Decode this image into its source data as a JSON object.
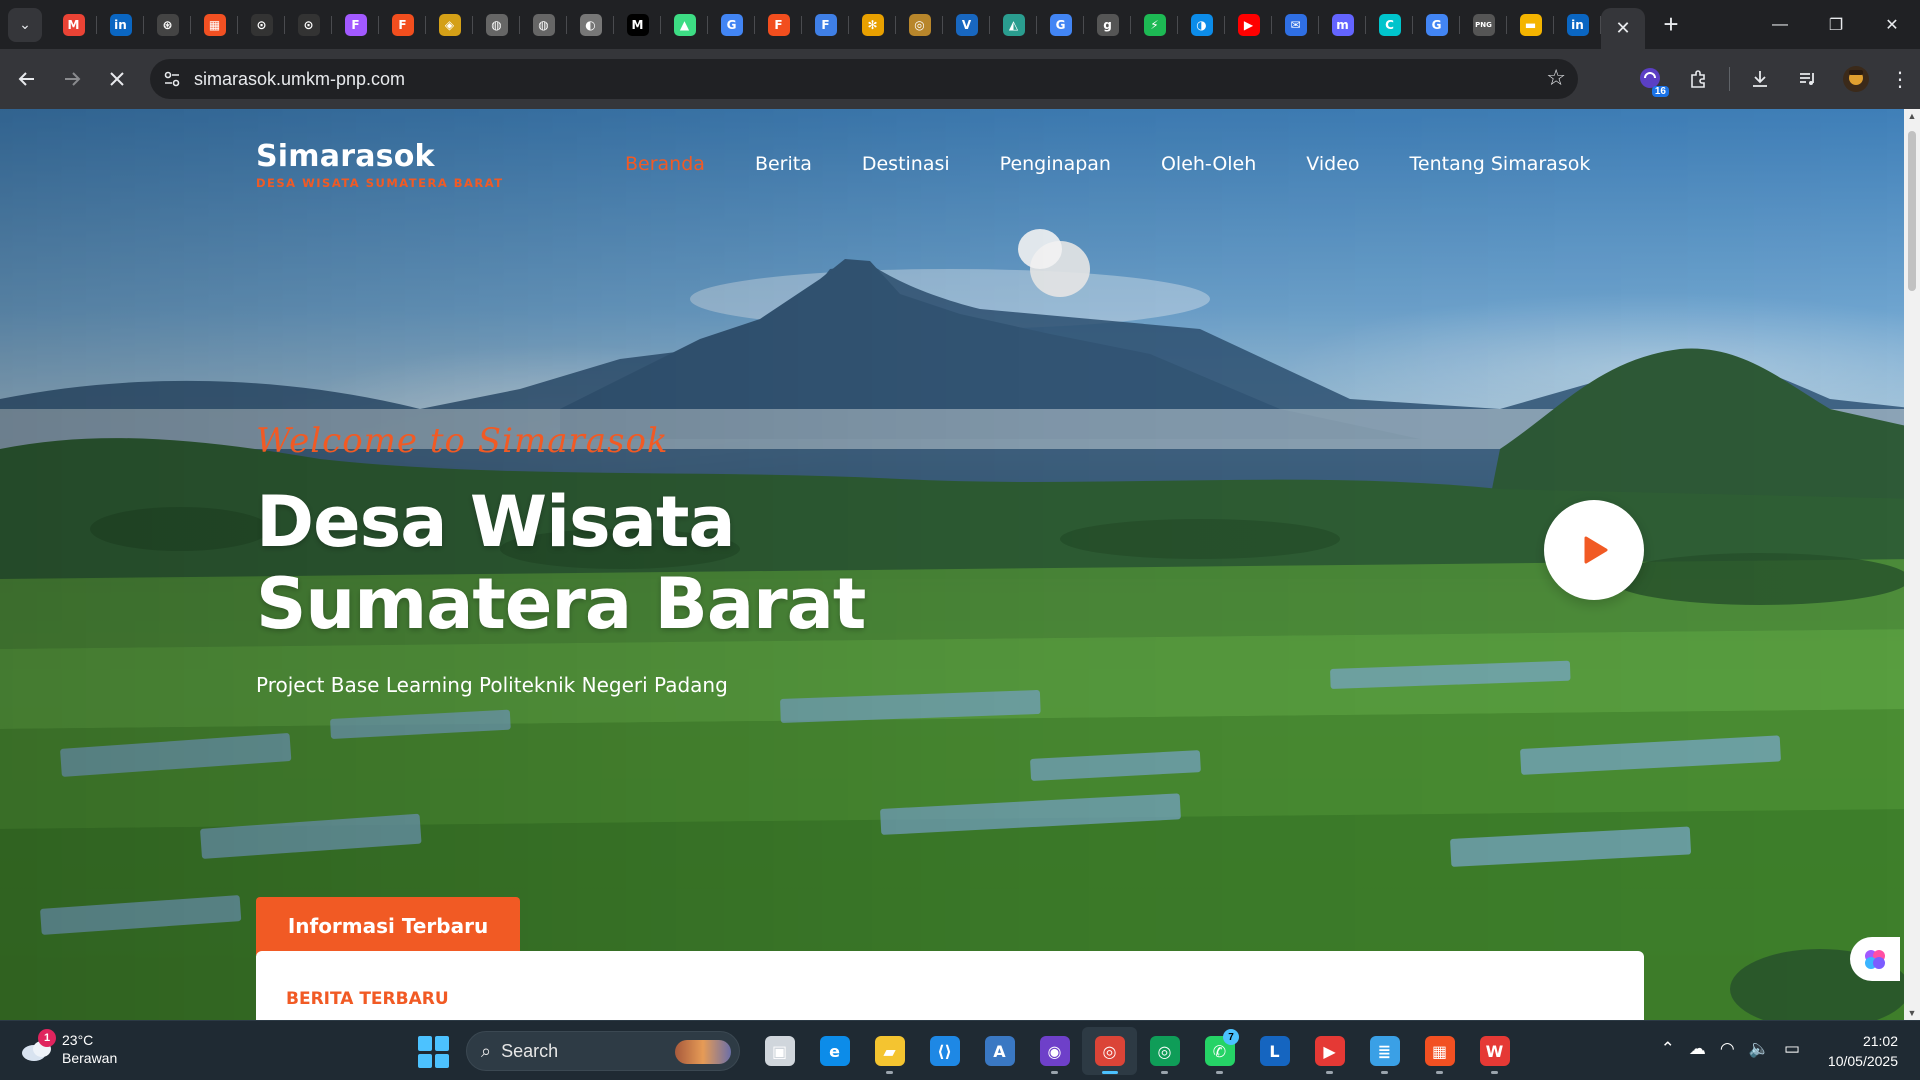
{
  "browser": {
    "pinned_tabs": [
      {
        "name": "gmail",
        "glyph": "M",
        "color": "#ea4335"
      },
      {
        "name": "linkedin",
        "glyph": "in",
        "color": "#0a66c2"
      },
      {
        "name": "openai",
        "glyph": "⊛",
        "color": "#444"
      },
      {
        "name": "microsoft",
        "glyph": "▦",
        "color": "#f25022"
      },
      {
        "name": "github",
        "glyph": "⊙",
        "color": "#333"
      },
      {
        "name": "github-2",
        "glyph": "⊙",
        "color": "#333"
      },
      {
        "name": "figma-circle",
        "glyph": "F",
        "color": "#a259ff"
      },
      {
        "name": "figma",
        "glyph": "F",
        "color": "#f24e1e"
      },
      {
        "name": "shield",
        "glyph": "◈",
        "color": "#d4a017"
      },
      {
        "name": "globe-1",
        "glyph": "◍",
        "color": "#666"
      },
      {
        "name": "globe-2",
        "glyph": "◍",
        "color": "#666"
      },
      {
        "name": "globe-3",
        "glyph": "◐",
        "color": "#777"
      },
      {
        "name": "medium",
        "glyph": "M",
        "color": "#000"
      },
      {
        "name": "android",
        "glyph": "▲",
        "color": "#3ddc84"
      },
      {
        "name": "google",
        "glyph": "G",
        "color": "#4285f4"
      },
      {
        "name": "figma-2",
        "glyph": "F",
        "color": "#f24e1e"
      },
      {
        "name": "forms",
        "glyph": "F",
        "color": "#3f7fe6"
      },
      {
        "name": "chrome-web",
        "glyph": "✻",
        "color": "#e8a000"
      },
      {
        "name": "badge",
        "glyph": "◎",
        "color": "#b8862b"
      },
      {
        "name": "vuetify",
        "glyph": "V",
        "color": "#1867c0"
      },
      {
        "name": "renovation",
        "glyph": "◭",
        "color": "#2a9d8f"
      },
      {
        "name": "google-2",
        "glyph": "G",
        "color": "#4285f4"
      },
      {
        "name": "grammarly",
        "glyph": "g",
        "color": "#555"
      },
      {
        "name": "bolt",
        "glyph": "⚡",
        "color": "#1db954"
      },
      {
        "name": "edge",
        "glyph": "◑",
        "color": "#0c8ce9"
      },
      {
        "name": "youtube",
        "glyph": "▶",
        "color": "#ff0000"
      },
      {
        "name": "mail-app",
        "glyph": "✉",
        "color": "#2f6fe4"
      },
      {
        "name": "mastodon",
        "glyph": "m",
        "color": "#6364ff"
      },
      {
        "name": "canva",
        "glyph": "C",
        "color": "#00c4cc"
      },
      {
        "name": "google-3",
        "glyph": "G",
        "color": "#4285f4"
      },
      {
        "name": "png",
        "glyph": "PNG",
        "color": "#555"
      },
      {
        "name": "slides",
        "glyph": "▬",
        "color": "#f4b400"
      },
      {
        "name": "linkedin-2",
        "glyph": "in",
        "color": "#0a66c2"
      }
    ],
    "active_tab_close": "✕",
    "new_tab": "+",
    "window_controls": [
      "—",
      "❐",
      "✕"
    ],
    "address": "simarasok.umkm-pnp.com",
    "extension_badge": "16"
  },
  "page": {
    "brand_name": "Simarasok",
    "brand_tagline": "DESA WISATA SUMATERA BARAT",
    "nav": [
      {
        "label": "Beranda",
        "active": true
      },
      {
        "label": "Berita",
        "active": false
      },
      {
        "label": "Destinasi",
        "active": false
      },
      {
        "label": "Penginapan",
        "active": false
      },
      {
        "label": "Oleh-Oleh",
        "active": false
      },
      {
        "label": "Video",
        "active": false
      },
      {
        "label": "Tentang Simarasok",
        "active": false
      }
    ],
    "welcome": "Welcome to Simarasok",
    "hero_title_line1": "Desa Wisata",
    "hero_title_line2": "Sumatera Barat",
    "hero_subtitle": "Project Base Learning Politeknik Negeri Padang",
    "info_tab": "Informasi Terbaru",
    "info_section_label": "BERITA TERBARU",
    "accent_color": "#f15a24"
  },
  "taskbar": {
    "weather_temp": "23°C",
    "weather_desc": "Berawan",
    "weather_badge": "1",
    "search_label": "Search",
    "apps": [
      {
        "name": "task-view",
        "glyph": "▣",
        "color": "#d0d6dc"
      },
      {
        "name": "edge",
        "glyph": "e",
        "color": "#0c8ce9"
      },
      {
        "name": "file-explorer",
        "glyph": "▰",
        "color": "#f4c430"
      },
      {
        "name": "vscode",
        "glyph": "⟨⟩",
        "color": "#1e88e5"
      },
      {
        "name": "app-a",
        "glyph": "A",
        "color": "#3a78c3"
      },
      {
        "name": "github-desktop",
        "glyph": "◉",
        "color": "#6e40c9"
      },
      {
        "name": "chrome",
        "glyph": "◎",
        "color": "#db4437"
      },
      {
        "name": "chrome-2",
        "glyph": "◎",
        "color": "#0f9d58"
      },
      {
        "name": "whatsapp",
        "glyph": "✆",
        "color": "#25d366"
      },
      {
        "name": "app-l",
        "glyph": "L",
        "color": "#1565c0"
      },
      {
        "name": "media",
        "glyph": "▶",
        "color": "#e53935"
      },
      {
        "name": "notepad",
        "glyph": "≣",
        "color": "#3aa0e6"
      },
      {
        "name": "store",
        "glyph": "▦",
        "color": "#f25022"
      },
      {
        "name": "wps",
        "glyph": "W",
        "color": "#e53935"
      }
    ],
    "whatsapp_count": "7",
    "time": "21:02",
    "date": "10/05/2025"
  }
}
